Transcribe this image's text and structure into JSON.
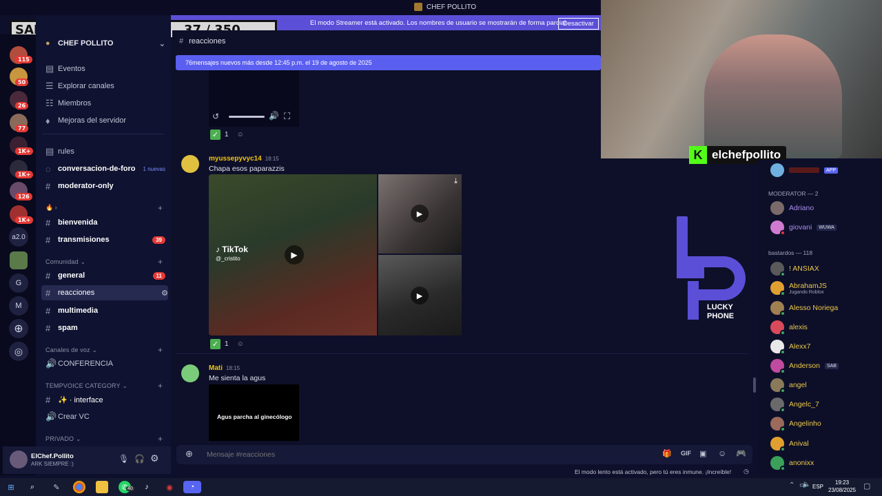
{
  "server_title": "CHEF POLLITO",
  "overlay": {
    "title": "SALTO A LA PISINA",
    "counter": "37 / 350"
  },
  "streamer_banner": {
    "text": "El modo Streamer está activado. Los nombres de usuario se mostrarán de forma parcial.",
    "button": "Desactivar"
  },
  "guilds": {
    "badges": [
      "115",
      "50",
      "26",
      "77",
      "1K+",
      "1K+",
      "126",
      "1K+"
    ],
    "texts": [
      "a2.0",
      "G",
      "M"
    ]
  },
  "sidebar": {
    "server_name": "CHEF POLLITO",
    "menu": [
      "Eventos",
      "Explorar canales",
      "Miembros",
      "Mejoras del servidor"
    ],
    "channels_top": [
      {
        "name": "rules"
      },
      {
        "name": "conversacion-de-foro",
        "tag": "1 nuevas"
      },
      {
        "name": "moderator-only"
      }
    ],
    "channels_mid": [
      {
        "name": "bienvenida"
      },
      {
        "name": "transmisiones",
        "count": "39"
      }
    ],
    "cat_comunidad": "Comunidad",
    "channels_com": [
      {
        "name": "general",
        "count": "11"
      },
      {
        "name": "reacciones"
      },
      {
        "name": "multimedia"
      },
      {
        "name": "spam"
      }
    ],
    "cat_voz": "Canales de voz",
    "voice_channel": "CONFERENCIA",
    "cat_tempvoice": "TEMPVOICE CATEGORY",
    "interface_channel": "✨ · interface",
    "create_vc": "Crear VC",
    "cat_privado": "PRIVADO"
  },
  "user_panel": {
    "name": "ElChef.Pollito",
    "status": "ARK SIEMPRE :)"
  },
  "chat": {
    "channel": "reacciones",
    "new_messages": "76mensajes nuevos más desde 12:45 p.m. el 19 de agosto de 2025",
    "reaction_count": "1",
    "messages": [
      {
        "author": "myussepyvyc14",
        "time": "18:15",
        "text": "Chapa esos paparazzis",
        "author_color": "#f1c40f"
      },
      {
        "author": "Mati",
        "time": "18:15",
        "text": "Me sienta la agus",
        "author_color": "#f1c40f"
      }
    ],
    "tiktok_label": "TikTok",
    "tiktok_handle": "@_cristito",
    "embed_text": "Agus parcha al ginecólogo",
    "input_placeholder": "Mensaje #reacciones",
    "slowmode": "El modo lento está activado, pero tú eres inmune. ¡Increíble!"
  },
  "webcam": {
    "name": "elchefpollito"
  },
  "logo": {
    "text1": "LUCKY",
    "text2": "PHONE"
  },
  "members": {
    "top_tag": "APP",
    "moderator_header": "MODERATOR — 2",
    "moderators": [
      {
        "name": "Adriano"
      },
      {
        "name": "giovani",
        "badge": "WUWA"
      }
    ],
    "bastardos_header": "bastardos — 118",
    "list": [
      {
        "name": "! ANSIAX"
      },
      {
        "name": "AbrahamJS",
        "sub": "Jugando Roblox"
      },
      {
        "name": "Alesso Noriega"
      },
      {
        "name": "alexis"
      },
      {
        "name": "Alexx7"
      },
      {
        "name": "Anderson",
        "badge": "SAB"
      },
      {
        "name": "angel"
      },
      {
        "name": "Angelc_7"
      },
      {
        "name": "Angelinho"
      },
      {
        "name": "Anival"
      },
      {
        "name": "anonixx"
      }
    ]
  },
  "taskbar": {
    "lang": "ESP",
    "time": "19:23",
    "date": "23/08/2025",
    "whatsapp_badge": "40"
  },
  "colors": {
    "accent": "#5865f2",
    "banner": "#5b4fd8",
    "online": "#3ba55c",
    "gold": "#ecc94b"
  }
}
